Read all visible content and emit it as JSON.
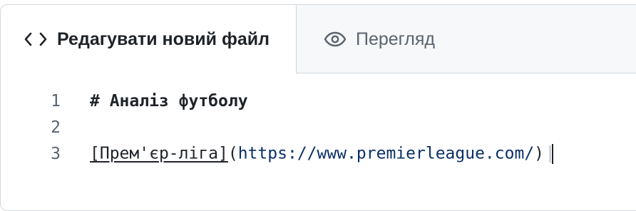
{
  "tabs": {
    "edit": {
      "label": "Редагувати новий файл",
      "icon": "code-icon"
    },
    "preview": {
      "label": "Перегляд",
      "icon": "eye-icon"
    }
  },
  "editor": {
    "lines": [
      {
        "number": "1",
        "heading_text": "# Аналіз футболу"
      },
      {
        "number": "2"
      },
      {
        "number": "3",
        "link_open": "[",
        "link_text": "Прем'єр-ліга",
        "link_close": "]",
        "paren_open": "(",
        "url": "https://www.premierleague.com/",
        "paren_close": ")"
      }
    ]
  },
  "colors": {
    "border": "#d0d7de",
    "tab_bar_bg": "#f6f8fa",
    "text": "#1f2328",
    "muted": "#59636e",
    "url": "#0a3069"
  }
}
